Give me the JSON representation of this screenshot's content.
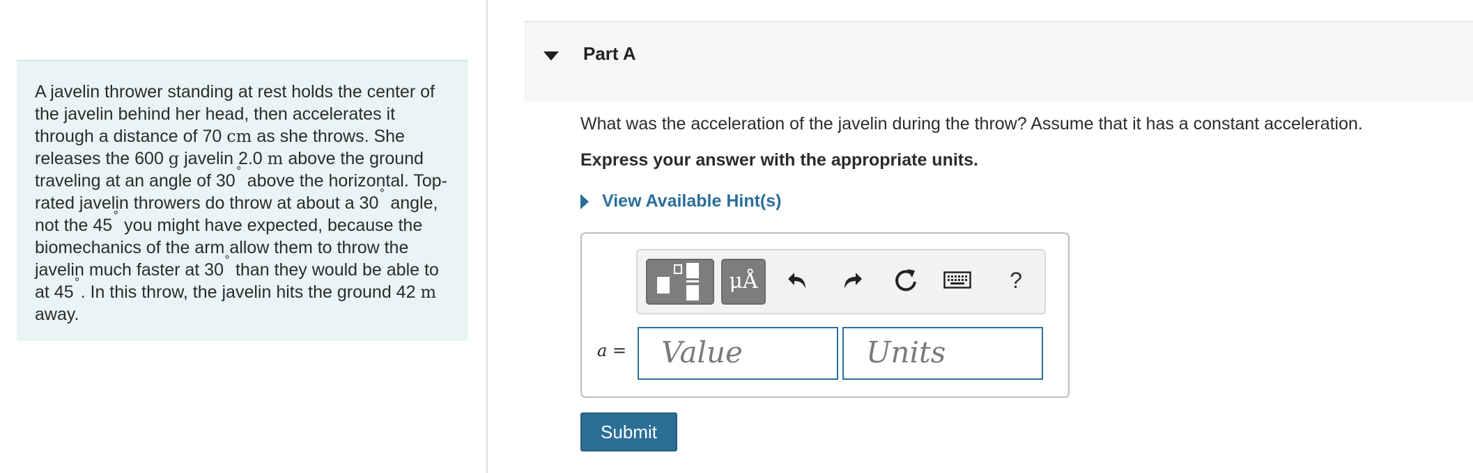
{
  "problem": {
    "s1": "A javelin thrower standing at rest holds the center of the javelin behind her head, then accelerates it through a distance of 70 ",
    "u_cm": "cm",
    "s2": " as she throws. She releases the 600 ",
    "u_g": "g",
    "s3": " javelin 2.0 ",
    "u_m1": "m",
    "s4": " above the ground traveling at an angle of 30",
    "deg1": "∘",
    "s5": " above the horizontal. Top-rated javelin throwers do throw at about a 30",
    "deg2": "∘",
    "s6": " angle, not the 45",
    "deg3": "∘",
    "s7": " you might have expected, because the biomechanics of the arm allow them to throw the javelin much faster at 30",
    "deg4": "∘",
    "s8": " than they would be able to at 45",
    "deg5": "∘",
    "s9": ". In this throw, the javelin hits the ground 42 ",
    "u_m2": "m",
    "s10": " away."
  },
  "part": {
    "title": "Part A",
    "question": "What was the acceleration of the javelin during the throw? Assume that it has a constant acceleration.",
    "instructions": "Express your answer with the appropriate units.",
    "hint_label": "View Available Hint(s)"
  },
  "answer": {
    "variable": "a",
    "equals": "=",
    "value_placeholder": "Value",
    "units_placeholder": "Units",
    "submit_label": "Submit"
  },
  "toolbar": {
    "symbol_label": "μÅ",
    "help_label": "?",
    "icons": [
      "templates-icon",
      "symbols-icon",
      "undo-icon",
      "redo-icon",
      "reset-icon",
      "keyboard-icon",
      "help-icon"
    ]
  },
  "colors": {
    "panel_bg": "#e8f5f4",
    "link": "#2a6f99",
    "button": "#2b6f97"
  }
}
